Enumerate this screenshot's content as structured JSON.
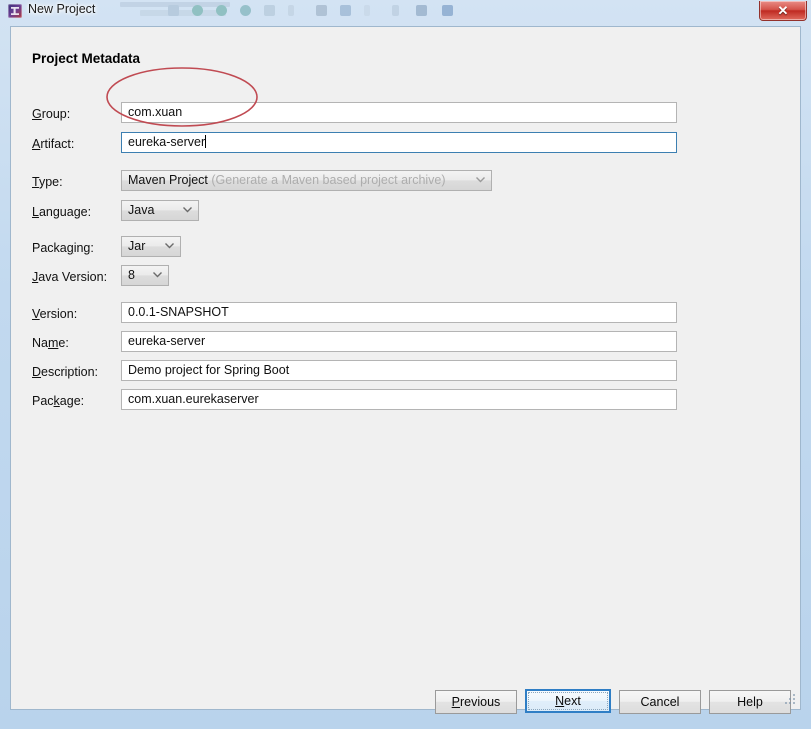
{
  "window": {
    "title": "New Project",
    "icon": "intellij-idea-icon",
    "close_label": "✕",
    "chrome_color": "#c2d9ef"
  },
  "dialog": {
    "section_title": "Project Metadata",
    "fields": [
      {
        "id": "group",
        "label": "Group:",
        "mnemonic": "G",
        "value": "com.xuan",
        "type": "text",
        "focused": false
      },
      {
        "id": "artifact",
        "label": "Artifact:",
        "mnemonic": "A",
        "value": "eureka-server",
        "type": "text",
        "focused": true
      },
      {
        "id": "type",
        "label": "Type:",
        "mnemonic": "T",
        "value": "Maven Project",
        "hint": "(Generate a Maven based project archive)",
        "type": "combo"
      },
      {
        "id": "language",
        "label": "Language:",
        "mnemonic": "L",
        "value": "Java",
        "type": "combo"
      },
      {
        "id": "packaging",
        "label": "Packaging:",
        "mnemonic": "g",
        "value": "Jar",
        "type": "combo"
      },
      {
        "id": "java-version",
        "label": "Java Version:",
        "mnemonic": "J",
        "value": "8",
        "type": "combo"
      },
      {
        "id": "version",
        "label": "Version:",
        "mnemonic": "V",
        "value": "0.0.1-SNAPSHOT",
        "type": "text",
        "focused": false
      },
      {
        "id": "name",
        "label": "Name:",
        "mnemonic": "m",
        "value": "eureka-server",
        "type": "text",
        "focused": false
      },
      {
        "id": "description",
        "label": "Description:",
        "mnemonic": "D",
        "value": "Demo project for Spring Boot",
        "type": "text",
        "focused": false
      },
      {
        "id": "package",
        "label": "Package:",
        "mnemonic": "k",
        "value": "com.xuan.eurekaserver",
        "type": "text",
        "focused": false
      }
    ]
  },
  "buttons": {
    "previous": "Previous",
    "next": "Next",
    "cancel": "Cancel",
    "help": "Help"
  },
  "annotation": {
    "shape": "ellipse",
    "color": "#c04a52",
    "targets": "group-and-artifact-fields"
  }
}
